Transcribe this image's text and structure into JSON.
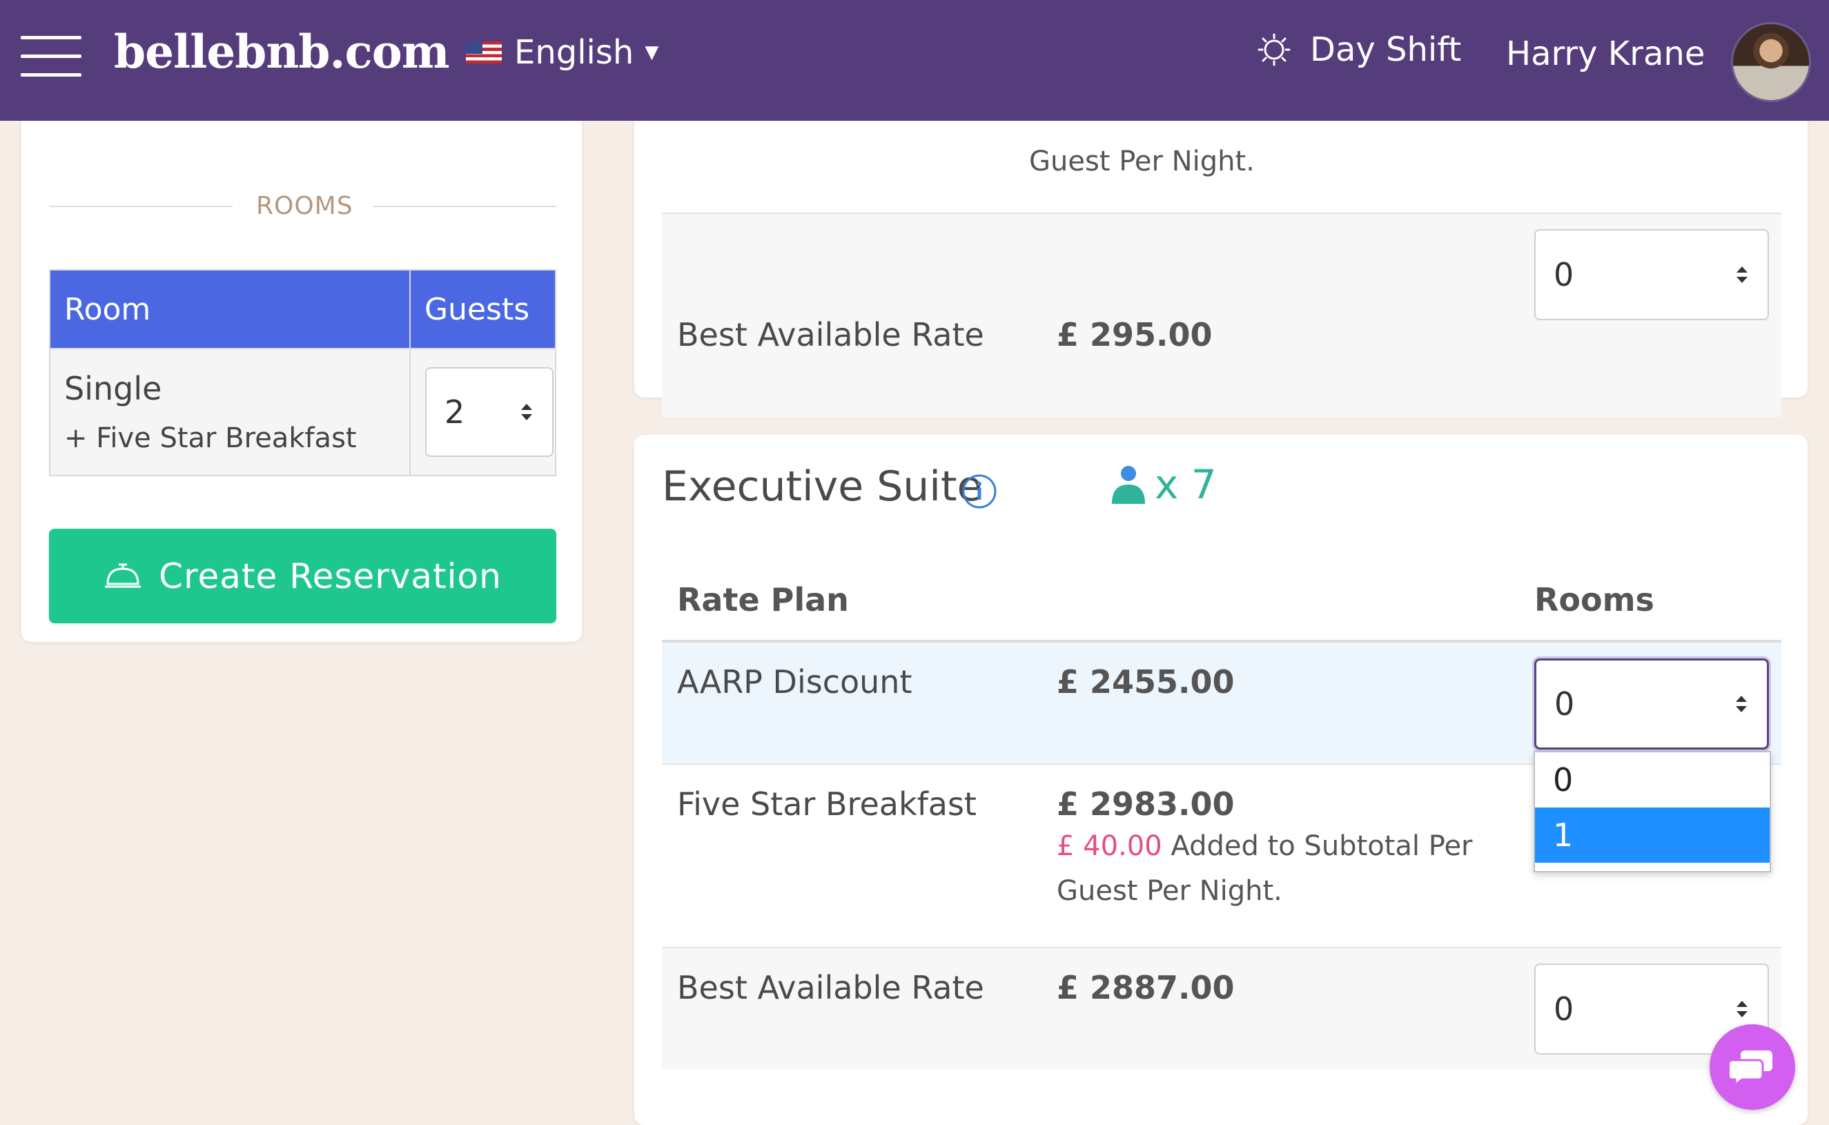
{
  "header": {
    "brand": "bellebnb.com",
    "language": "English",
    "shift": "Day Shift",
    "user_name": "Harry Krane",
    "colors": {
      "bar": "#553c7b",
      "text": "#ffffff"
    }
  },
  "left_panel": {
    "section_title": "ROOMS",
    "table_headers": {
      "room": "Room",
      "guests": "Guests"
    },
    "rows": [
      {
        "room": "Single",
        "extra": "+ Five Star Breakfast",
        "guests": "2"
      }
    ],
    "create_button": "Create Reservation",
    "colors": {
      "header": "#4b68e2",
      "button": "#1ec78e"
    }
  },
  "previous_room": {
    "partial_note_line": "Guest Per Night.",
    "rates": [
      {
        "name": "Best Available Rate",
        "price": "£ 295.00",
        "rooms": "0"
      }
    ]
  },
  "executive_suite": {
    "title": "Executive Suite",
    "guest_capacity": "x 7",
    "column_rate_plan": "Rate Plan",
    "column_rooms": "Rooms",
    "rates": [
      {
        "name": "AARP Discount",
        "price": "£ 2455.00",
        "rooms": "0"
      },
      {
        "name": "Five Star Breakfast",
        "price": "£ 2983.00",
        "note_amount": "£ 40.00",
        "note_text": "Added to Subtotal Per Guest Per Night.",
        "rooms": "0"
      },
      {
        "name": "Best Available Rate",
        "price": "£ 2887.00",
        "rooms": "0"
      }
    ],
    "dropdown_options": [
      "0",
      "1"
    ],
    "dropdown_selected": "1"
  },
  "icons": [
    "hamburger-icon",
    "us-flag-icon",
    "chevron-down-icon",
    "sun-icon",
    "avatar",
    "bell-icon",
    "info-icon",
    "guest-icon",
    "chat-icon"
  ]
}
